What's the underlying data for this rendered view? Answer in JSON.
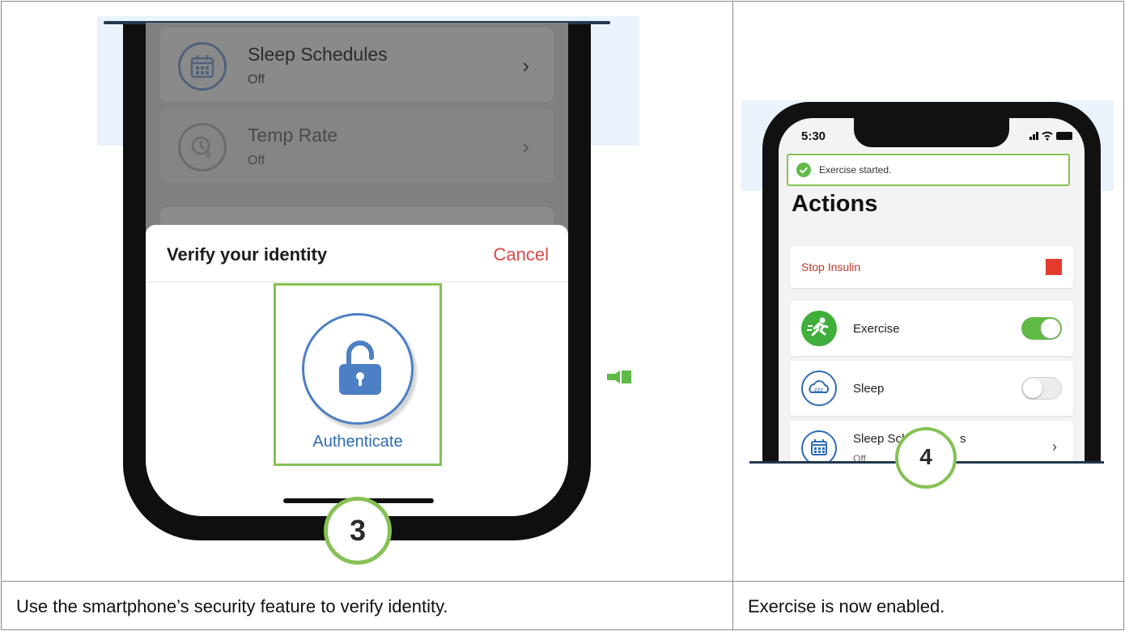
{
  "left_panel": {
    "items": [
      {
        "title": "Sleep Schedules",
        "status": "Off",
        "icon": "calendar-icon"
      },
      {
        "title": "Temp Rate",
        "status": "Off",
        "icon": "temp-rate-icon"
      }
    ],
    "dialog": {
      "title": "Verify your identity",
      "cancel_label": "Cancel",
      "authenticate_label": "Authenticate",
      "icon": "lock-icon"
    },
    "step_number": "3",
    "caption": "Use the smartphone’s security feature to verify identity."
  },
  "right_panel": {
    "status_bar": {
      "time": "5:30"
    },
    "toast": "Exercise started.",
    "title": "Actions",
    "stop_insulin_label": "Stop Insulin",
    "rows": [
      {
        "label": "Exercise",
        "icon": "exercise-icon",
        "toggle": "on"
      },
      {
        "label": "Sleep",
        "icon": "sleep-icon",
        "toggle": "off"
      }
    ],
    "partial_row": {
      "label_visible": "Sleep Sch",
      "label_tail": "s",
      "status": "Off",
      "icon": "calendar-icon"
    },
    "step_number": "4",
    "caption": "Exercise is now enabled."
  },
  "colors": {
    "step_green": "#86c154",
    "toggle_on": "#5fba46",
    "stop_red": "#e53a2e",
    "cancel_red": "#e04848",
    "accent_blue": "#2f6ab5"
  }
}
